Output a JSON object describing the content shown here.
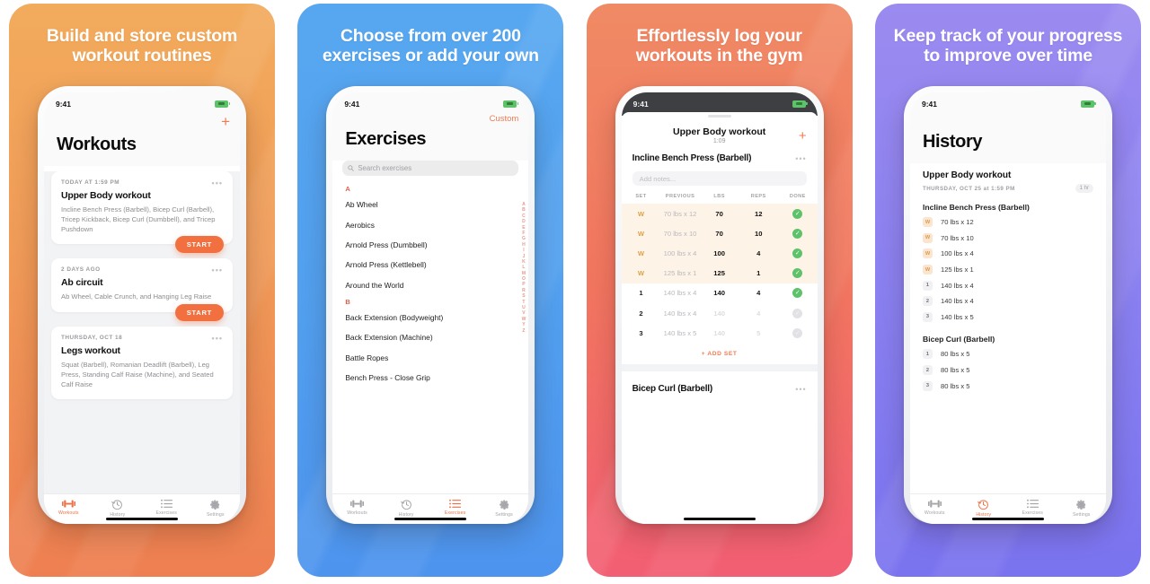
{
  "panels": [
    {
      "id": "build-store",
      "headline": "Build and store custom workout routines",
      "bg_top": "#f2ab5c",
      "bg_bottom": "#ef7f52",
      "status": {
        "time": "9:41"
      },
      "screen": {
        "title": "Workouts",
        "add_icon": "+",
        "cards": [
          {
            "meta": "TODAY AT 1:59 PM",
            "name": "Upper Body workout",
            "desc": "Incline Bench Press (Barbell), Bicep Curl (Barbell), Tricep Kickback, Bicep Curl (Dumbbell), and Tricep Pushdown",
            "start": "START"
          },
          {
            "meta": "2 DAYS AGO",
            "name": "Ab circuit",
            "desc": "Ab Wheel, Cable Crunch, and Hanging Leg Raise",
            "start": "START"
          },
          {
            "meta": "THURSDAY, OCT 18",
            "name": "Legs workout",
            "desc": "Squat (Barbell), Romanian Deadlift (Barbell), Leg Press, Standing Calf Raise (Machine), and Seated Calf Raise",
            "start": "START"
          }
        ]
      },
      "tabs": {
        "active": "Workouts",
        "items": [
          "Workouts",
          "History",
          "Exercises",
          "Settings"
        ]
      }
    },
    {
      "id": "choose-exercises",
      "headline": "Choose from over 200 exercises or add your own",
      "bg_top": "#57a7f0",
      "bg_bottom": "#4e96ee",
      "status": {
        "time": "9:41"
      },
      "screen": {
        "custom_label": "Custom",
        "title": "Exercises",
        "search_placeholder": "Search exercises",
        "sections": [
          {
            "letter": "A",
            "items": [
              "Ab Wheel",
              "Aerobics",
              "Arnold Press (Dumbbell)",
              "Arnold Press (Kettlebell)",
              "Around the World"
            ]
          },
          {
            "letter": "B",
            "items": [
              "Back Extension (Bodyweight)",
              "Back Extension (Machine)",
              "Battle Ropes",
              "Bench Press - Close Grip"
            ]
          }
        ],
        "alpha_index": [
          "A",
          "B",
          "C",
          "D",
          "E",
          "F",
          "G",
          "H",
          "I",
          "J",
          "K",
          "L",
          "M",
          "O",
          "P",
          "R",
          "S",
          "T",
          "U",
          "V",
          "W",
          "Y",
          "Z"
        ]
      },
      "tabs": {
        "active": "Exercises",
        "items": [
          "Workouts",
          "History",
          "Exercises",
          "Settings"
        ]
      }
    },
    {
      "id": "log-workouts",
      "headline": "Effortlessly log your workouts in the gym",
      "bg_top": "#f08a65",
      "bg_bottom": "#f25e73",
      "status": {
        "time": "9:41",
        "dark": true
      },
      "screen": {
        "workout_title": "Upper Body workout",
        "timer": "1:09",
        "add_icon": "+",
        "exercise_title": "Incline Bench Press (Barbell)",
        "notes_placeholder": "Add notes...",
        "columns": [
          "SET",
          "PREVIOUS",
          "LBS",
          "REPS",
          "DONE"
        ],
        "rows": [
          {
            "set": "W",
            "warmup": true,
            "previous": "70 lbs x 12",
            "lbs": "70",
            "reps": "12",
            "done": true
          },
          {
            "set": "W",
            "warmup": true,
            "previous": "70 lbs x 10",
            "lbs": "70",
            "reps": "10",
            "done": true
          },
          {
            "set": "W",
            "warmup": true,
            "previous": "100 lbs x 4",
            "lbs": "100",
            "reps": "4",
            "done": true
          },
          {
            "set": "W",
            "warmup": true,
            "previous": "125 lbs x 1",
            "lbs": "125",
            "reps": "1",
            "done": true
          },
          {
            "set": "1",
            "warmup": false,
            "previous": "140 lbs x 4",
            "lbs": "140",
            "reps": "4",
            "done": true
          },
          {
            "set": "2",
            "warmup": false,
            "previous": "140 lbs x 4",
            "lbs": "140",
            "reps": "4",
            "done": false
          },
          {
            "set": "3",
            "warmup": false,
            "previous": "140 lbs x 5",
            "lbs": "140",
            "reps": "5",
            "done": false
          }
        ],
        "add_set_label": "+  ADD SET",
        "next_exercise": "Bicep Curl (Barbell)"
      },
      "tabs": null
    },
    {
      "id": "track-progress",
      "headline": "Keep track of your progress to improve over time",
      "bg_top": "#9b8bf0",
      "bg_bottom": "#7b74ef",
      "status": {
        "time": "9:41"
      },
      "screen": {
        "title": "History",
        "entry": {
          "workout": "Upper Body workout",
          "date": "THURSDAY, OCT 25 at 1:59 PM",
          "duration": "1 hr",
          "exercises": [
            {
              "name": "Incline Bench Press (Barbell)",
              "sets": [
                {
                  "label": "W",
                  "warmup": true,
                  "text": "70 lbs x 12"
                },
                {
                  "label": "W",
                  "warmup": true,
                  "text": "70 lbs x 10"
                },
                {
                  "label": "W",
                  "warmup": true,
                  "text": "100 lbs x 4"
                },
                {
                  "label": "W",
                  "warmup": true,
                  "text": "125 lbs x 1"
                },
                {
                  "label": "1",
                  "warmup": false,
                  "text": "140 lbs x 4"
                },
                {
                  "label": "2",
                  "warmup": false,
                  "text": "140 lbs x 4"
                },
                {
                  "label": "3",
                  "warmup": false,
                  "text": "140 lbs x 5"
                }
              ]
            },
            {
              "name": "Bicep Curl (Barbell)",
              "sets": [
                {
                  "label": "1",
                  "warmup": false,
                  "text": "80 lbs x 5"
                },
                {
                  "label": "2",
                  "warmup": false,
                  "text": "80 lbs x 5"
                },
                {
                  "label": "3",
                  "warmup": false,
                  "text": "80 lbs x 5"
                }
              ]
            }
          ]
        }
      },
      "tabs": {
        "active": "History",
        "items": [
          "Workouts",
          "History",
          "Exercises",
          "Settings"
        ]
      }
    }
  ],
  "colors": {
    "accent": "#ef7b52",
    "start_button": "#f2703f",
    "done_green": "#5ec26a",
    "warmup": "#dda24a"
  }
}
